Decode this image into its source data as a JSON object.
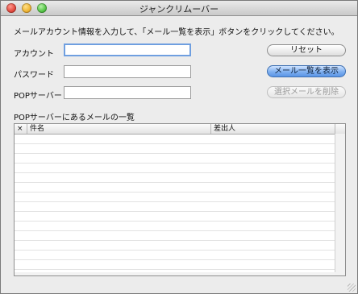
{
  "window": {
    "title": "ジャンクリムーバー"
  },
  "instructions": "メールアカウント情報を入力して、「メール一覧を表示」ボタンをクリックしてください。",
  "form": {
    "account": {
      "label": "アカウント",
      "value": ""
    },
    "password": {
      "label": "パスワード",
      "value": ""
    },
    "pop_server": {
      "label": "POPサーバー",
      "value": ""
    }
  },
  "buttons": {
    "reset": "リセット",
    "show_list": "メール一覧を表示",
    "delete_selected": "選択メールを削除"
  },
  "mail_list": {
    "title": "POPサーバーにあるメールの一覧",
    "columns": [
      "×",
      "件名",
      "差出人"
    ],
    "rows": []
  }
}
